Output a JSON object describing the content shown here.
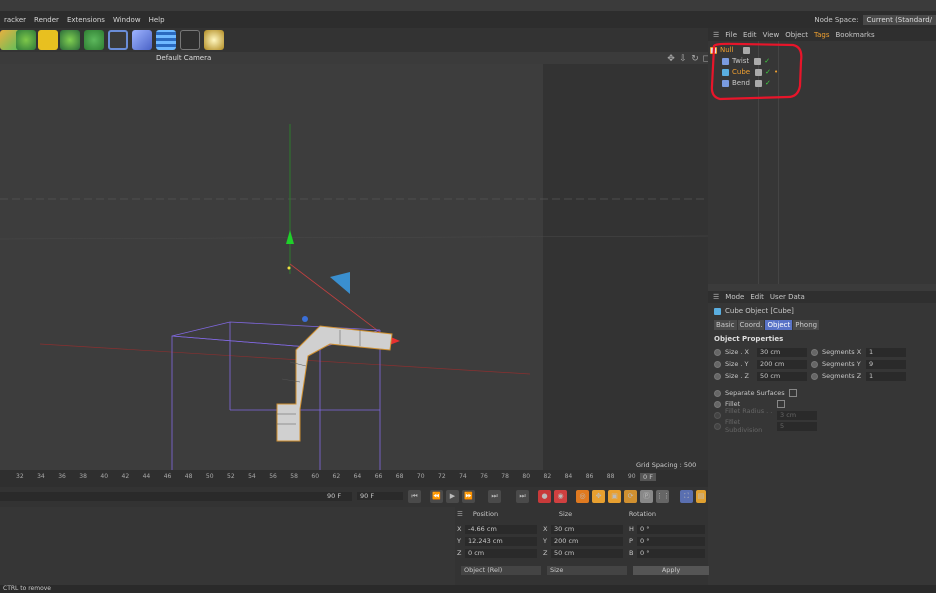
{
  "menubar": {
    "items": [
      "racker",
      "Render",
      "Extensions",
      "Window",
      "Help"
    ],
    "node_space_label": "Node Space:",
    "node_space_value": "Current (Standard/"
  },
  "viewport": {
    "camera_label": "Default Camera",
    "grid_spacing": "Grid Spacing : 500 cm"
  },
  "object_manager": {
    "menu": [
      "File",
      "Edit",
      "View",
      "Object",
      "Tags",
      "Bookmarks"
    ],
    "objects": [
      {
        "name": "Null",
        "icon": "null-icon",
        "color": "#e0a040"
      },
      {
        "name": "Twist",
        "icon": "twist-deformer-icon",
        "color": "#cfcfcf"
      },
      {
        "name": "Cube",
        "icon": "cube-icon",
        "color": "#f0a030"
      },
      {
        "name": "Bend",
        "icon": "bend-deformer-icon",
        "color": "#cfcfcf"
      }
    ]
  },
  "attributes": {
    "menu": [
      "Mode",
      "Edit",
      "User Data"
    ],
    "title": "Cube Object [Cube]",
    "tabs": [
      "Basic",
      "Coord.",
      "Object",
      "Phong"
    ],
    "active_tab": "Object",
    "section": "Object Properties",
    "size_x_label": "Size . X",
    "size_x": "30 cm",
    "size_y_label": "Size . Y",
    "size_y": "200 cm",
    "size_z_label": "Size . Z",
    "size_z": "50 cm",
    "seg_x_label": "Segments X",
    "seg_x": "1",
    "seg_y_label": "Segments Y",
    "seg_y": "9",
    "seg_z_label": "Segments Z",
    "seg_z": "1",
    "separate_surfaces": "Separate Surfaces",
    "fillet": "Fillet",
    "fillet_radius_label": "Fillet Radius . . . .",
    "fillet_radius": "3 cm",
    "fillet_subdiv_label": "Fillet Subdivision",
    "fillet_subdiv": "5"
  },
  "timeline": {
    "ticks": [
      "32",
      "34",
      "36",
      "38",
      "40",
      "42",
      "44",
      "46",
      "48",
      "50",
      "52",
      "54",
      "56",
      "58",
      "60",
      "62",
      "64",
      "66",
      "68",
      "70",
      "72",
      "74",
      "76",
      "78",
      "80",
      "82",
      "84",
      "86",
      "88",
      "90"
    ],
    "current_frame": "0 F",
    "end_frame_a": "90 F",
    "end_frame_b": "90 F"
  },
  "coordinates": {
    "headers": [
      "Position",
      "Size",
      "Rotation"
    ],
    "pos": [
      {
        "axis": "X",
        "value": "-4.66 cm"
      },
      {
        "axis": "Y",
        "value": "12.243 cm"
      },
      {
        "axis": "Z",
        "value": "0 cm"
      }
    ],
    "size": [
      {
        "axis": "X",
        "value": "30 cm"
      },
      {
        "axis": "Y",
        "value": "200 cm"
      },
      {
        "axis": "Z",
        "value": "50 cm"
      }
    ],
    "rot": [
      {
        "axis": "H",
        "value": "0 °"
      },
      {
        "axis": "P",
        "value": "0 °"
      },
      {
        "axis": "B",
        "value": "0 °"
      }
    ],
    "mode_select": "Object (Rel)",
    "size_select": "Size",
    "apply_label": "Apply"
  },
  "status": {
    "text": "CTRL to remove"
  },
  "colors": {
    "accent": "#5973c7",
    "annotation": "#e8152a",
    "selected_object": "#f0a030"
  }
}
